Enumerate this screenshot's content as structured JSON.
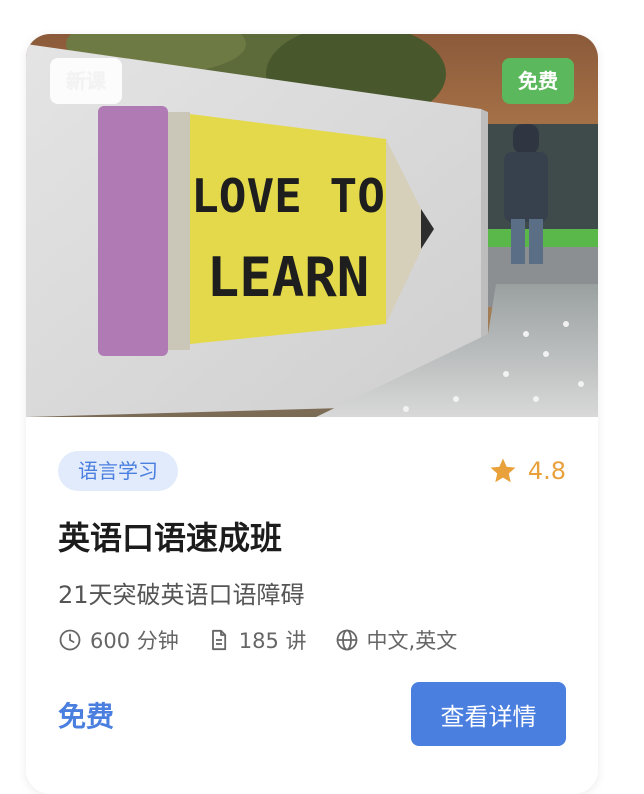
{
  "course": {
    "badge_new": "新课",
    "badge_free": "免费",
    "category": "语言学习",
    "rating": "4.8",
    "title": "英语口语速成班",
    "subtitle": "21天突破英语口语障碍",
    "duration": "600 分钟",
    "lessons": "185 讲",
    "languages": "中文,英文",
    "price": "免费",
    "detail_button": "查看详情",
    "cover_sign_line1": "LOVE TO",
    "cover_sign_line2": "LEARN"
  },
  "colors": {
    "accent": "#4a7fe0",
    "free_badge": "#5cb85c",
    "star": "#e8a13b",
    "category_bg": "#e1ebfb"
  },
  "icons": [
    "clock-icon",
    "document-icon",
    "globe-icon",
    "star-icon"
  ]
}
